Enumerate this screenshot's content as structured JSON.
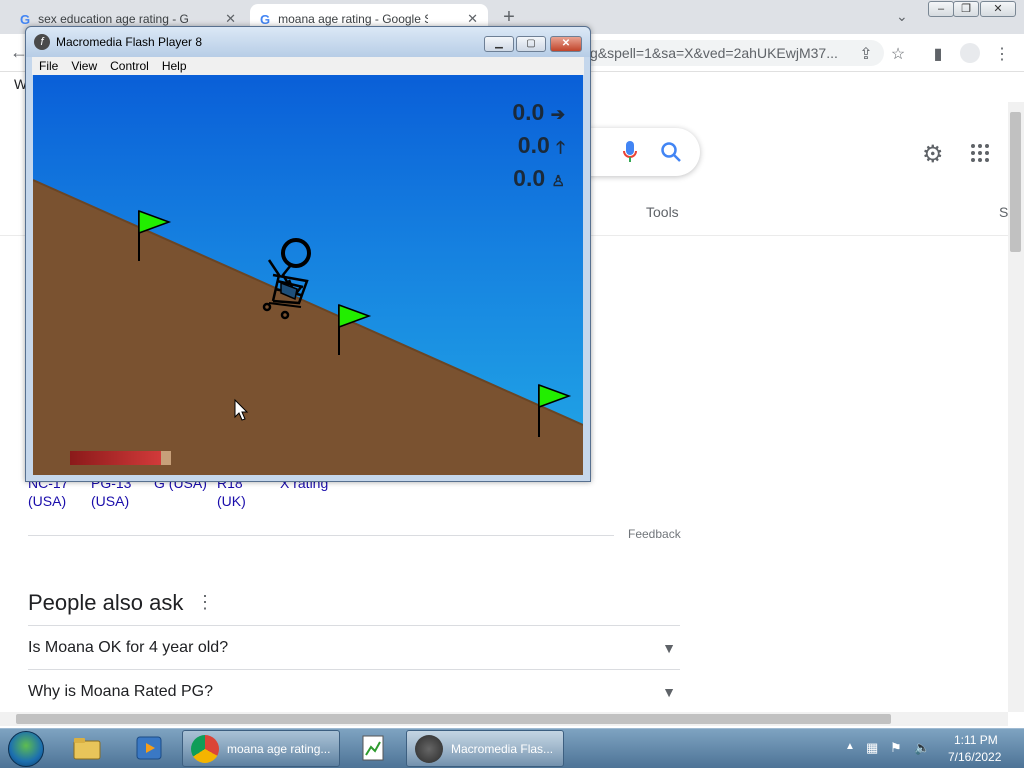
{
  "browser": {
    "tabs": [
      {
        "title": "sex education age rating - Google",
        "close": "✕"
      },
      {
        "title": "moana age rating - Google Search",
        "close": "✕"
      }
    ],
    "new_tab": "+",
    "url_fragment": "g&spell=1&sa=X&ved=2ahUKEwjM37...",
    "bookmark_letter": "W"
  },
  "google": {
    "tools_label": "Tools",
    "s_label": "S",
    "ratings": [
      {
        "line1": "NC-17",
        "line2": "(USA)"
      },
      {
        "line1": "PG-13",
        "line2": "(USA)"
      },
      {
        "line1": "G (USA)",
        "line2": ""
      },
      {
        "line1": "R18",
        "line2": "(UK)"
      },
      {
        "line1": "X rating",
        "line2": ""
      }
    ],
    "feedback": "Feedback",
    "people_also_ask": "People also ask",
    "questions": [
      "Is Moana OK for 4 year old?",
      "Why is Moana Rated PG?"
    ]
  },
  "flash": {
    "title": "Macromedia Flash Player 8",
    "menu": [
      "File",
      "View",
      "Control",
      "Help"
    ],
    "stats": [
      {
        "value": "0.0",
        "icon": "arrow-right-icon"
      },
      {
        "value": "0.0",
        "icon": "arrow-up-icon"
      },
      {
        "value": "0.0",
        "icon": "stickman-icon"
      }
    ],
    "power_level": 0.9,
    "colors": {
      "sky_top": "#0a5fd8",
      "sky_bottom": "#22a8e6",
      "ground": "#7a5230",
      "flag": "#22ee00",
      "power_bar": "#c0282a"
    }
  },
  "taskbar": {
    "buttons": [
      {
        "label": "moana age rating..."
      },
      {
        "label": "Macromedia Flas..."
      }
    ],
    "time": "1:11 PM",
    "date": "7/16/2022"
  }
}
